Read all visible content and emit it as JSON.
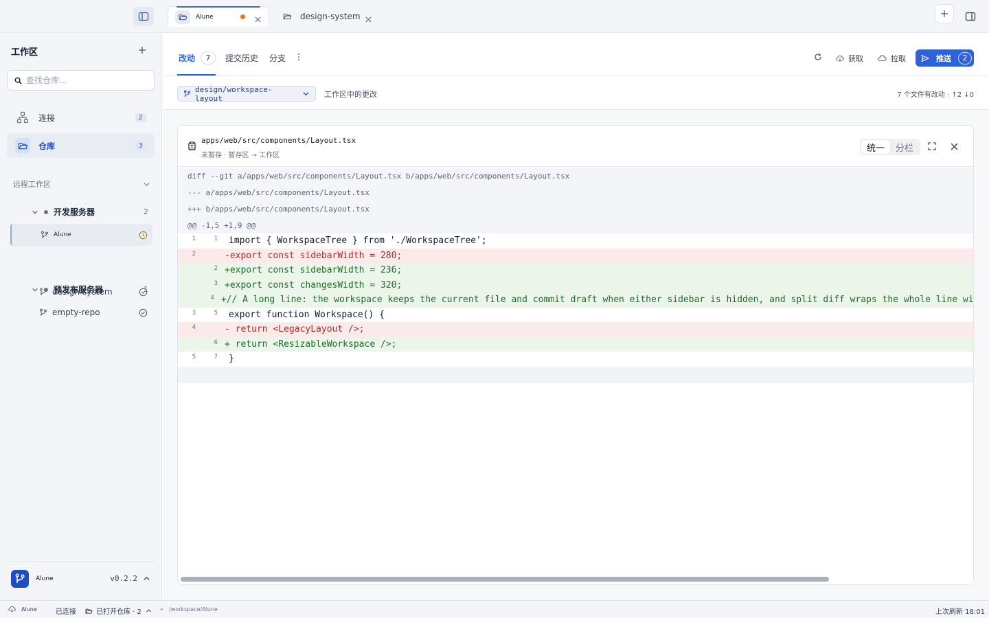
{
  "titlebar": {
    "tabs": [
      {
        "label": "Alune",
        "modified": true
      },
      {
        "label": "design-system",
        "modified": false
      }
    ]
  },
  "sidebar": {
    "title": "工作区",
    "search_placeholder": "查找仓库...",
    "nav": [
      {
        "label": "连接",
        "count": "2",
        "icon": "network-icon"
      },
      {
        "label": "仓库",
        "count": "3",
        "icon": "folder-open-icon"
      }
    ],
    "remote_section": "远程工作区",
    "servers": [
      {
        "name": "开发服务器",
        "count": "2",
        "repos": [
          {
            "name": "Alune",
            "status": "clock-icon"
          },
          {
            "name": "design-system",
            "status": "check-circle-icon"
          }
        ]
      },
      {
        "name": "预发布服务器",
        "count": "1",
        "repos": [
          {
            "name": "empty-repo",
            "status": "check-circle-icon"
          }
        ]
      }
    ],
    "footer": {
      "app_name": "Alune",
      "version": "v0.2.2"
    }
  },
  "main": {
    "tabs": [
      {
        "label": "改动",
        "count": "7"
      },
      {
        "label": "提交历史"
      },
      {
        "label": "分支"
      }
    ],
    "actions": {
      "fetch": "获取",
      "pull": "拉取",
      "push": "推送",
      "push_count": "2"
    },
    "branch": {
      "name": "design/workspace-layout",
      "description": "工作区中的更改",
      "summary": "7 个文件有改动 · ↑2 ↓0"
    }
  },
  "diff": {
    "file_path": "apps/web/src/components/Layout.tsx",
    "file_subtitle": "未暂存 · 暂存区 → 工作区",
    "view_modes": [
      "统一",
      "分栏"
    ],
    "active_view": "统一",
    "header_lines": [
      "diff --git a/apps/web/src/components/Layout.tsx b/apps/web/src/components/Layout.tsx",
      "--- a/apps/web/src/components/Layout.tsx",
      "+++ b/apps/web/src/components/Layout.tsx",
      "@@ -1,5 +1,9 @@"
    ],
    "lines": [
      {
        "type": "ctx",
        "old": "1",
        "new": "1",
        "text": "import { WorkspaceTree } from './WorkspaceTree';"
      },
      {
        "type": "del",
        "old": "2",
        "new": "",
        "text": "-export const sidebarWidth = 280;"
      },
      {
        "type": "add",
        "old": "",
        "new": "2",
        "text": "+export const sidebarWidth = 236;"
      },
      {
        "type": "add",
        "old": "",
        "new": "3",
        "text": "+export const changesWidth = 320;"
      },
      {
        "type": "add",
        "old": "",
        "new": "4",
        "text": "+// A long line: the workspace keeps the current file and commit draft when either sidebar is hidden, and split diff wraps the whole line without clipping."
      },
      {
        "type": "ctx",
        "old": "3",
        "new": "5",
        "text": "export function Workspace() {"
      },
      {
        "type": "del",
        "old": "4",
        "new": "",
        "text": "-  return <LegacyLayout />;"
      },
      {
        "type": "add",
        "old": "",
        "new": "6",
        "text": "+  return <ResizableWorkspace />;"
      },
      {
        "type": "ctx",
        "old": "5",
        "new": "7",
        "text": "}"
      }
    ]
  },
  "statusbar": {
    "host": "Alune",
    "connection": "已连接",
    "repos_open": "已打开仓库 · 2",
    "path": "/workspace/Alune",
    "last_refresh": "上次刷新 18:01"
  }
}
